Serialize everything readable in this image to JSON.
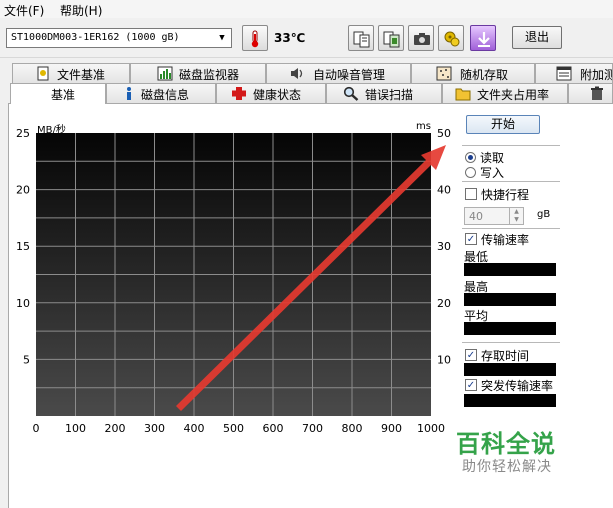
{
  "menu": {
    "items": [
      {
        "label": "文件(F)"
      },
      {
        "label": "帮助(H)"
      }
    ]
  },
  "toolbar": {
    "drive": "ST1000DM003-1ER162 (1000 gB)",
    "temperature": "33℃",
    "exit_label": "退出",
    "icons": [
      "thermometer-icon",
      "copy-text-icon",
      "copy-screen-icon",
      "camera-icon",
      "options-icon",
      "download-icon"
    ]
  },
  "tabs": {
    "row1": [
      {
        "label": "文件基准",
        "icon": "file-benchmark-icon"
      },
      {
        "label": "磁盘监视器",
        "icon": "disk-monitor-icon"
      },
      {
        "label": "自动噪音管理",
        "icon": "speaker-icon"
      },
      {
        "label": "随机存取",
        "icon": "random-access-icon"
      },
      {
        "label": "附加测",
        "icon": "extra-tests-icon"
      }
    ],
    "row2": [
      {
        "label": "基准",
        "icon": ""
      },
      {
        "label": "磁盘信息",
        "icon": "info-icon"
      },
      {
        "label": "健康状态",
        "icon": "health-cross-icon"
      },
      {
        "label": "错误扫描",
        "icon": "magnifier-icon"
      },
      {
        "label": "文件夹占用率",
        "icon": "folder-icon"
      },
      {
        "label": "",
        "icon": "trash-icon"
      }
    ],
    "active": "基准"
  },
  "chart_data": {
    "type": "line",
    "title": "",
    "xlabel": "",
    "y_left_unit": "MB/秒",
    "y_right_unit": "ms",
    "x_ticks": [
      0,
      100,
      200,
      300,
      400,
      500,
      600,
      700,
      800,
      900,
      1000
    ],
    "y_left_ticks": [
      5,
      10,
      15,
      20,
      25
    ],
    "y_right_ticks": [
      10,
      20,
      30,
      40,
      50
    ],
    "xlim": [
      0,
      1000
    ],
    "ylim_left": [
      0,
      25
    ],
    "ylim_right": [
      0,
      50
    ],
    "grid": true,
    "series": []
  },
  "panel": {
    "start_label": "开始",
    "read_label": "读取",
    "write_label": "写入",
    "quick_label": "快捷行程",
    "quick_value": "40",
    "quick_unit": "gB",
    "transfer_label": "传输速率",
    "min_label": "最低",
    "max_label": "最高",
    "avg_label": "平均",
    "access_label": "存取时间",
    "burst_label": "突发传输速率"
  },
  "watermark": {
    "main": "百科全说",
    "sub": "助你轻松解决"
  },
  "colors": {
    "arrow": "#e53a30",
    "watermark": "#35a34a"
  }
}
